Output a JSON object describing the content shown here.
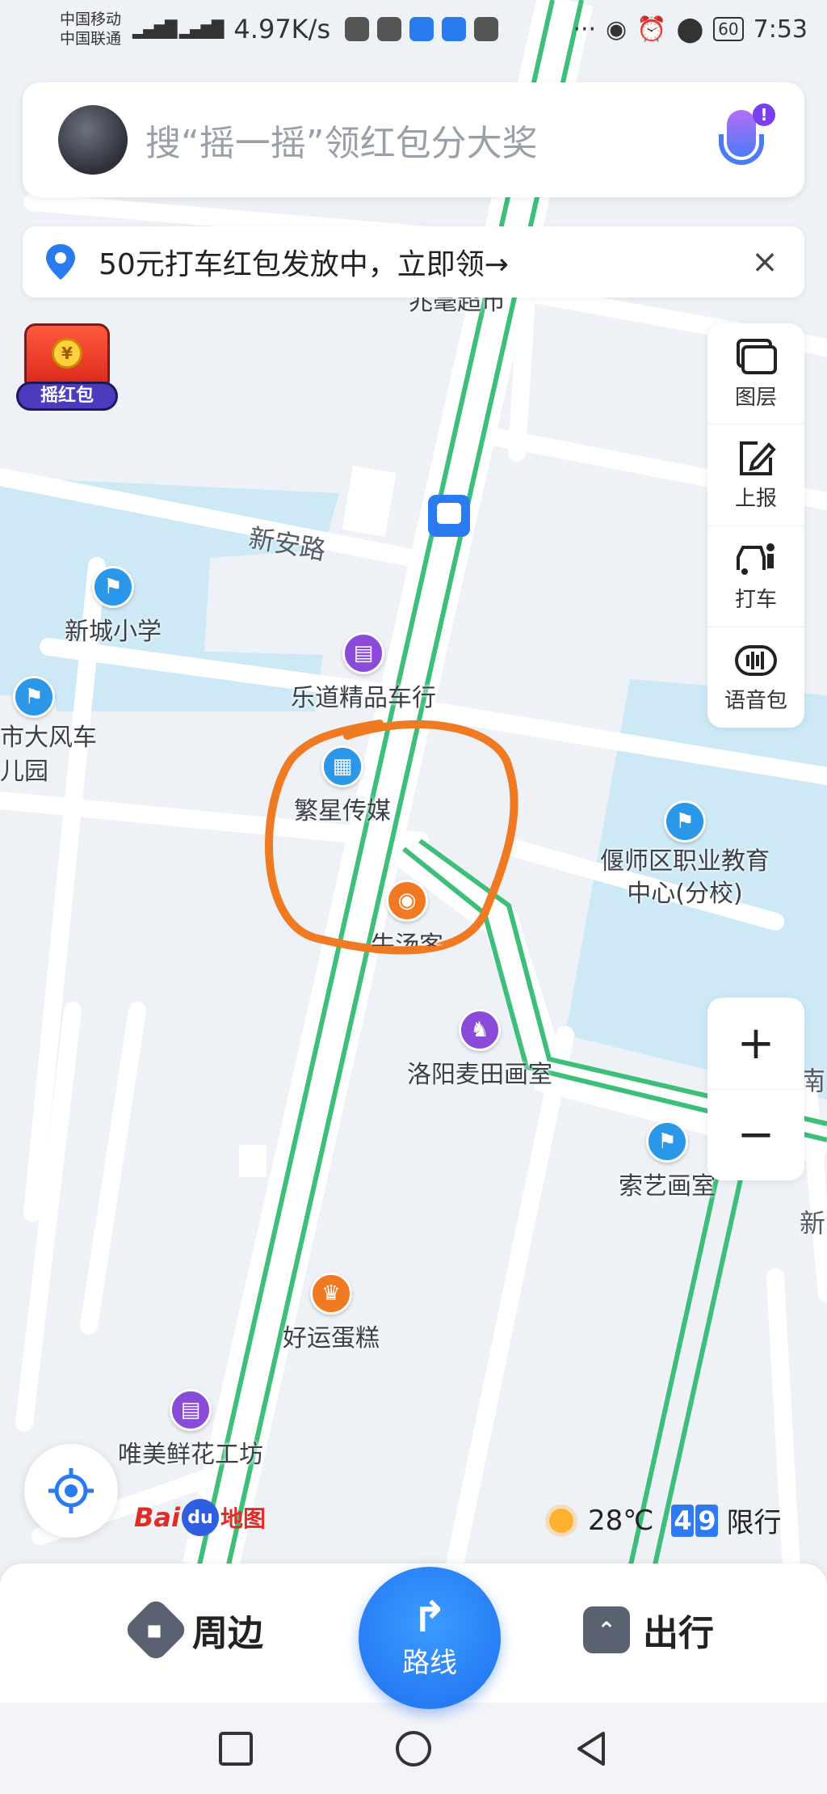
{
  "status_bar": {
    "carrier_1": "中国移动",
    "carrier_2": "中国联通",
    "net_speed": "4.97K/s",
    "battery": "60",
    "time": "7:53"
  },
  "search": {
    "placeholder": "搜“摇一摇”领红包分大奖",
    "mic_badge": "!"
  },
  "banner": {
    "text": "50元打车红包发放中，立即领→",
    "close": "×"
  },
  "red_packet": {
    "label": "摇红包",
    "coin": "¥"
  },
  "toolbar": [
    {
      "label": "图层",
      "icon": "layers-icon"
    },
    {
      "label": "上报",
      "icon": "edit-report-icon"
    },
    {
      "label": "打车",
      "icon": "taxi-icon"
    },
    {
      "label": "语音包",
      "icon": "voice-pack-icon"
    }
  ],
  "zoom": {
    "in": "+",
    "out": "−"
  },
  "map": {
    "road_label": "新安路",
    "pois": [
      {
        "name": "兆毫超市",
        "icon": "shop-icon",
        "color": "#8a4cd8"
      },
      {
        "name": "新城小学",
        "icon": "school-icon",
        "color": "#2b97e8"
      },
      {
        "name": "乐道精品车行",
        "icon": "shop-icon",
        "color": "#8a4cd8"
      },
      {
        "name": "繁星传媒",
        "icon": "company-icon",
        "color": "#2b97e8"
      },
      {
        "name": "偃师区职业教育\n中心(分校)",
        "icon": "school-icon",
        "color": "#2b97e8"
      },
      {
        "name": "牛汤客",
        "icon": "restaurant-icon",
        "color": "#f07a22"
      },
      {
        "name": "洛阳麦田画室",
        "icon": "toy-horse-icon",
        "color": "#8a4cd8"
      },
      {
        "name": "索艺画室",
        "icon": "school-icon",
        "color": "#2b97e8"
      },
      {
        "name": "好运蛋糕",
        "icon": "cake-icon",
        "color": "#f07a22"
      },
      {
        "name": "唯美鲜花工坊",
        "icon": "shop-icon",
        "color": "#8a4cd8"
      },
      {
        "name": "市大风车\n儿园",
        "icon": "school-icon",
        "color": "#2b97e8"
      },
      {
        "name": "新",
        "icon": "",
        "color": ""
      },
      {
        "name": "南",
        "icon": "",
        "color": ""
      }
    ]
  },
  "logo": {
    "bai": "Bai",
    "du": "du",
    "ditu": "地图"
  },
  "weather": {
    "temp": "28℃",
    "plate_1": "4",
    "plate_2": "9",
    "restriction": "限行"
  },
  "bottom_bar": {
    "nearby": "周边",
    "route": "路线",
    "travel": "出行"
  },
  "colors": {
    "accent": "#1f6ff0",
    "route_line": "#3dbf7a",
    "annotation": "#f07a22",
    "water": "#cde9f6"
  }
}
